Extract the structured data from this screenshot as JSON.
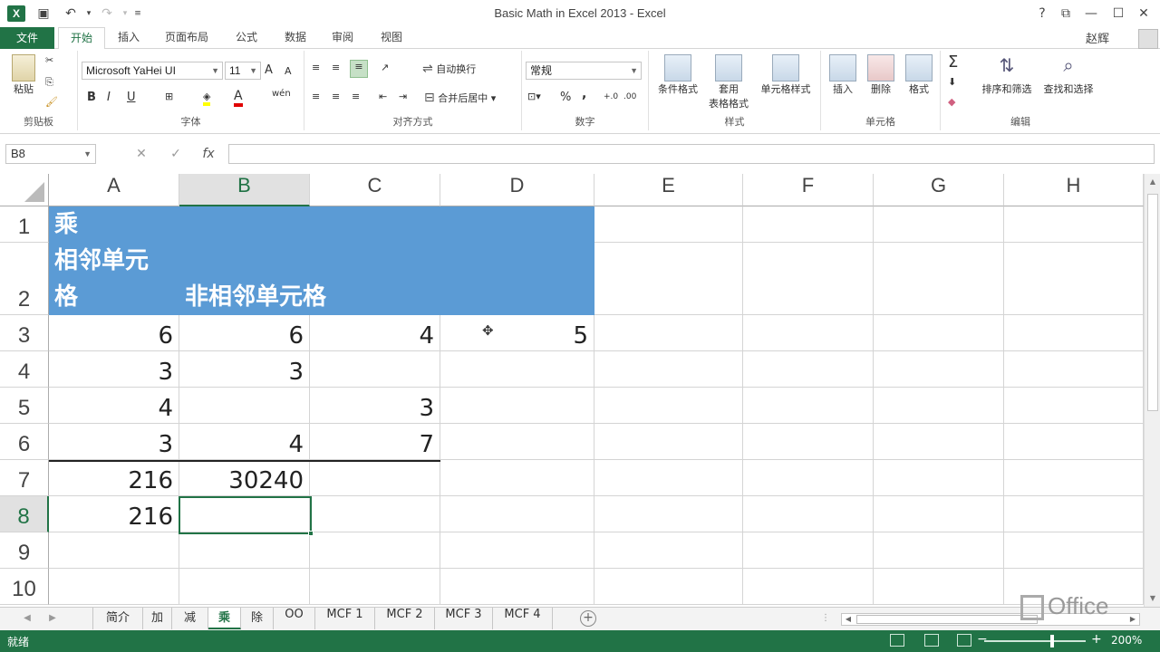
{
  "window": {
    "title": "Basic Math in Excel 2013 - Excel",
    "app_logo": "X",
    "help": "?",
    "user_name": "赵辉"
  },
  "tabs": [
    {
      "label": "文件"
    },
    {
      "label": "开始"
    },
    {
      "label": "插入"
    },
    {
      "label": "页面布局"
    },
    {
      "label": "公式"
    },
    {
      "label": "数据"
    },
    {
      "label": "审阅"
    },
    {
      "label": "视图"
    }
  ],
  "ribbon": {
    "clipboard": {
      "paste": "粘贴",
      "label": "剪贴板"
    },
    "font": {
      "name": "Microsoft YaHei UI",
      "size": "11",
      "label": "字体",
      "bold": "B",
      "italic": "I",
      "underline": "U",
      "grow": "A",
      "shrink": "A",
      "phonetic": "wén"
    },
    "alignment": {
      "wrap": "自动换行",
      "merge": "合并后居中",
      "label": "对齐方式"
    },
    "number": {
      "format": "常规",
      "percent": "%",
      "comma": ",",
      "label": "数字"
    },
    "styles": {
      "conditional": "条件格式",
      "table_line1": "套用",
      "table_line2": "表格格式",
      "cell_styles": "单元格样式",
      "label": "样式"
    },
    "cells": {
      "insert": "插入",
      "delete": "删除",
      "format": "格式",
      "label": "单元格"
    },
    "editing": {
      "sort": "排序和筛选",
      "find": "查找和选择",
      "label": "编辑"
    }
  },
  "formula_bar": {
    "name_box": "B8",
    "cancel": "✕",
    "enter": "✓",
    "fx": "fx",
    "value": ""
  },
  "sheet": {
    "columns": [
      "A",
      "B",
      "C",
      "D",
      "E",
      "F",
      "G",
      "H"
    ],
    "rows": [
      "1",
      "2",
      "3",
      "4",
      "5",
      "6",
      "7",
      "8",
      "9",
      "10"
    ],
    "selected_column": "B",
    "selected_row": "8",
    "header": {
      "a1": "乘",
      "a2_line1": "相邻单元",
      "a2_line2": "格",
      "b2": "非相邻单元格"
    },
    "cells": {
      "a3": "6",
      "b3": "6",
      "c3": "4",
      "d3": "5",
      "a4": "3",
      "b4": "3",
      "c5": "3",
      "a5": "4",
      "a6": "3",
      "b6": "4",
      "c6": "7",
      "a7": "216",
      "b7": "30240",
      "a8": "216"
    },
    "header_color": "#5b9bd5"
  },
  "sheet_tabs": [
    "简介",
    "加",
    "减",
    "乘",
    "除",
    "OO",
    "MCF 1",
    "MCF 2",
    "MCF 3",
    "MCF 4"
  ],
  "active_sheet": "乘",
  "status": {
    "ready": "就绪",
    "zoom": "200%",
    "zoom_level_percent": 200
  },
  "brand": {
    "office": "Office",
    "accent": "#217346"
  }
}
